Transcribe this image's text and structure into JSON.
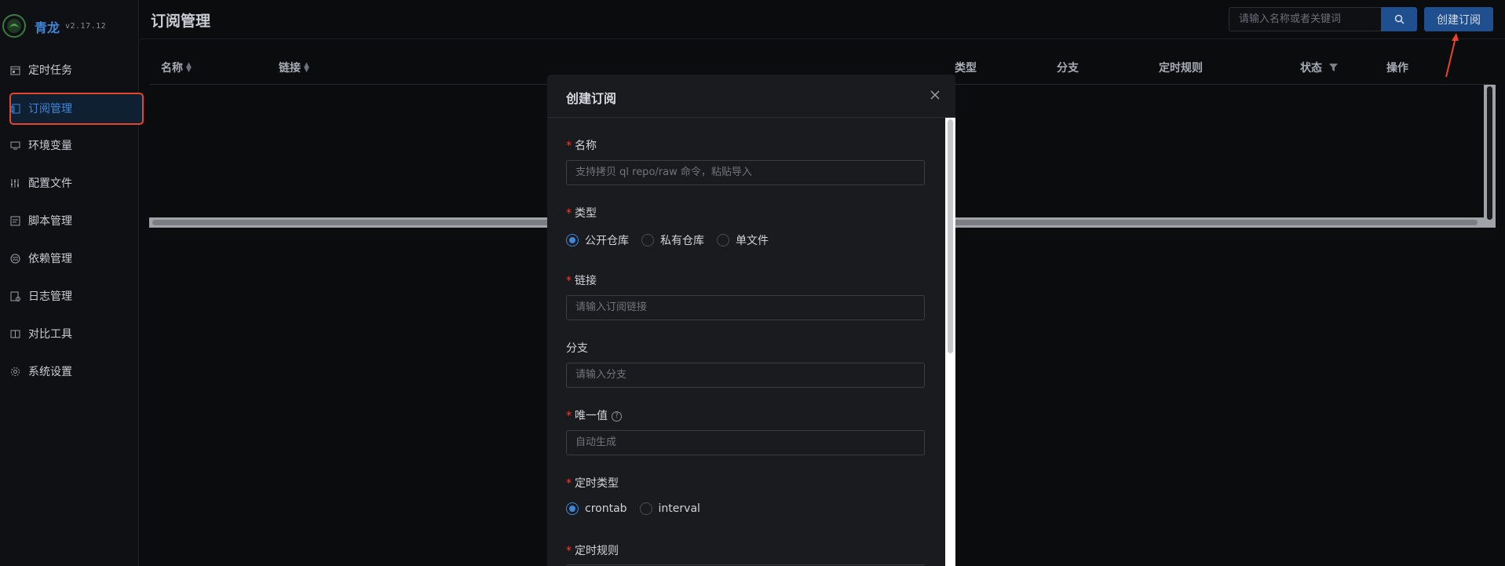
{
  "app": {
    "brand": "青龙",
    "version": "v2.17.12"
  },
  "sidebar": {
    "items": [
      {
        "label": "定时任务",
        "icon": "calendar-icon"
      },
      {
        "label": "订阅管理",
        "icon": "subscription-icon"
      },
      {
        "label": "环境变量",
        "icon": "monitor-icon"
      },
      {
        "label": "配置文件",
        "icon": "sliders-icon"
      },
      {
        "label": "脚本管理",
        "icon": "file-code-icon"
      },
      {
        "label": "依赖管理",
        "icon": "package-icon"
      },
      {
        "label": "日志管理",
        "icon": "log-file-icon"
      },
      {
        "label": "对比工具",
        "icon": "diff-icon"
      },
      {
        "label": "系统设置",
        "icon": "gear-icon"
      }
    ]
  },
  "header": {
    "title": "订阅管理",
    "search_placeholder": "请输入名称或者关键词",
    "create_label": "创建订阅"
  },
  "table": {
    "columns": [
      "名称",
      "链接",
      "类型",
      "分支",
      "定时规则",
      "状态",
      "操作"
    ]
  },
  "modal": {
    "title": "创建订阅",
    "fields": {
      "name": {
        "label": "名称",
        "placeholder": "支持拷贝 ql repo/raw 命令，粘贴导入"
      },
      "type": {
        "label": "类型",
        "options": [
          "公开仓库",
          "私有仓库",
          "单文件"
        ],
        "selected": "公开仓库"
      },
      "url": {
        "label": "链接",
        "placeholder": "请输入订阅链接"
      },
      "branch": {
        "label": "分支",
        "placeholder": "请输入分支"
      },
      "alias": {
        "label": "唯一值",
        "placeholder": "自动生成"
      },
      "schedule_type": {
        "label": "定时类型",
        "options": [
          "crontab",
          "interval"
        ],
        "selected": "crontab"
      },
      "schedule": {
        "label": "定时规则"
      }
    }
  },
  "colors": {
    "accent": "#3f86d8",
    "danger": "#e8432b",
    "background": "#0b0c0e"
  }
}
